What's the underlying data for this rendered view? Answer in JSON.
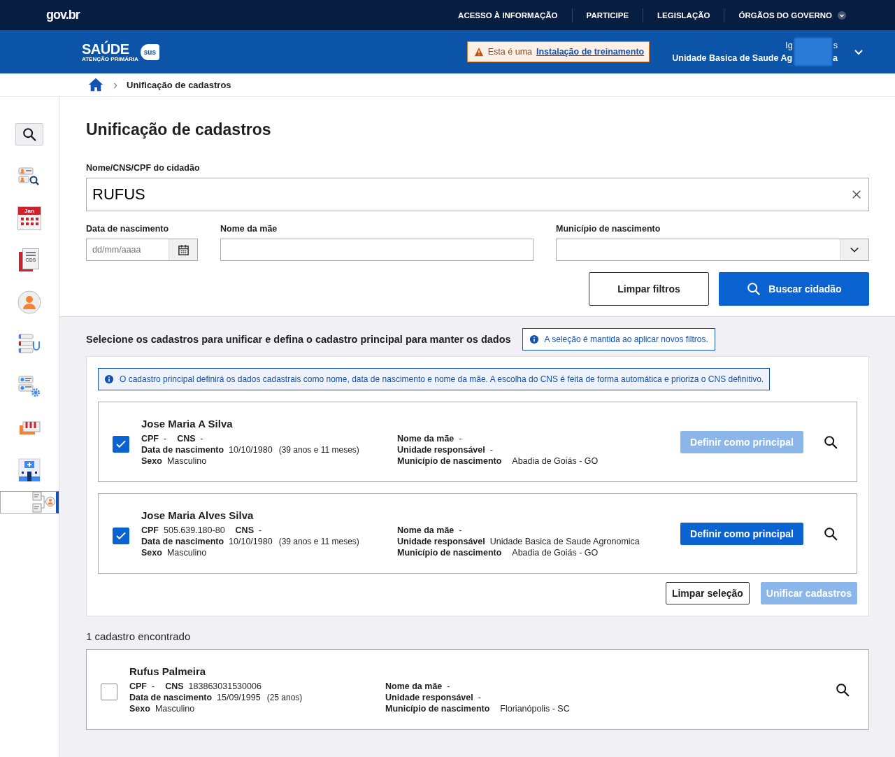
{
  "gov_bar": {
    "logo": "gov.br",
    "links": [
      "ACESSO À INFORMAÇÃO",
      "PARTICIPE",
      "LEGISLAÇÃO",
      "ÓRGÃOS DO GOVERNO"
    ]
  },
  "header": {
    "brand": "SAÚDE",
    "brand_sub": "ATENÇÃO PRIMÁRIA",
    "brand_badge": "sus",
    "notice_text": "Esta é uma",
    "notice_link": "Instalação de treinamento",
    "user_line_start": "Ig",
    "user_line_end": "s",
    "unit_start": "Unidade Basica de Saude Ag",
    "unit_end": "a"
  },
  "breadcrumb": {
    "separator": "›",
    "current": "Unificação de cadastros"
  },
  "sidebar": {
    "items": [
      {
        "kind": "search",
        "selected": false
      },
      {
        "kind": "citizen-search",
        "selected": false
      },
      {
        "kind": "calendar",
        "label": "Jan",
        "selected": false
      },
      {
        "kind": "cds",
        "label": "CDS",
        "selected": false
      },
      {
        "kind": "person",
        "selected": false
      },
      {
        "kind": "stethoscope",
        "selected": false
      },
      {
        "kind": "settings-list",
        "selected": false
      },
      {
        "kind": "rack",
        "selected": false
      },
      {
        "kind": "hospital",
        "selected": false
      },
      {
        "kind": "merge",
        "selected": true
      }
    ]
  },
  "page": {
    "title": "Unificação de cadastros",
    "filters": {
      "name_label": "Nome/CNS/CPF do cidadão",
      "name_value": "RUFUS",
      "birth_label": "Data de nascimento",
      "birth_placeholder": "dd/mm/aaaa",
      "mother_label": "Nome da mãe",
      "city_label": "Município de nascimento",
      "clear_button": "Limpar filtros",
      "search_button": "Buscar cidadão"
    },
    "selection": {
      "heading": "Selecione os cadastros para unificar e defina o cadastro principal para manter os dados",
      "hint": "A seleção é mantida ao aplicar novos filtros.",
      "info": "O cadastro principal definirá os dados cadastrais como nome, data de nascimento e nome da mãe. A escolha do CNS é feita de forma automática e prioriza o CNS definitivo.",
      "records": [
        {
          "labels": {
            "cpf": "CPF",
            "cns": "CNS",
            "birth": "Data de nascimento",
            "sex": "Sexo",
            "mother": "Nome da mãe",
            "unit": "Unidade responsável",
            "birthplace": "Município de nascimento"
          },
          "name": "Jose Maria A Silva",
          "checked": true,
          "cpf": "-",
          "cns": "-",
          "birth": "10/10/1980",
          "age": "(39 anos e 11 meses)",
          "sex": "Masculino",
          "mother": "-",
          "unit": "-",
          "birthplace": "Abadia de Goiás - GO",
          "principal_button": {
            "label": "Definir como principal",
            "disabled": true
          }
        },
        {
          "labels": {
            "cpf": "CPF",
            "cns": "CNS",
            "birth": "Data de nascimento",
            "sex": "Sexo",
            "mother": "Nome da mãe",
            "unit": "Unidade responsável",
            "birthplace": "Município de nascimento"
          },
          "name": "Jose Maria Alves Silva",
          "checked": true,
          "cpf": "505.639.180-80",
          "cns": "-",
          "birth": "10/10/1980",
          "age": "(39 anos e 11 meses)",
          "sex": "Masculino",
          "mother": "-",
          "unit": "Unidade Basica de Saude Agronomica",
          "birthplace": "Abadia de Goiás - GO",
          "principal_button": {
            "label": "Definir como principal",
            "disabled": false
          }
        }
      ],
      "clear_button": "Limpar seleção",
      "merge_button": {
        "label": "Unificar cadastros",
        "disabled": true
      }
    },
    "results": {
      "count": "1 cadastro encontrado",
      "records": [
        {
          "labels": {
            "cpf": "CPF",
            "cns": "CNS",
            "birth": "Data de nascimento",
            "sex": "Sexo",
            "mother": "Nome da mãe",
            "unit": "Unidade responsável",
            "birthplace": "Município de nascimento"
          },
          "name": "Rufus Palmeira",
          "checked": false,
          "cpf": "-",
          "cns": "183863031530006",
          "birth": "15/09/1995",
          "age": "(25 anos)",
          "sex": "Masculino",
          "mother": "-",
          "unit": "-",
          "birthplace": "Florianópolis - SC"
        }
      ]
    }
  }
}
